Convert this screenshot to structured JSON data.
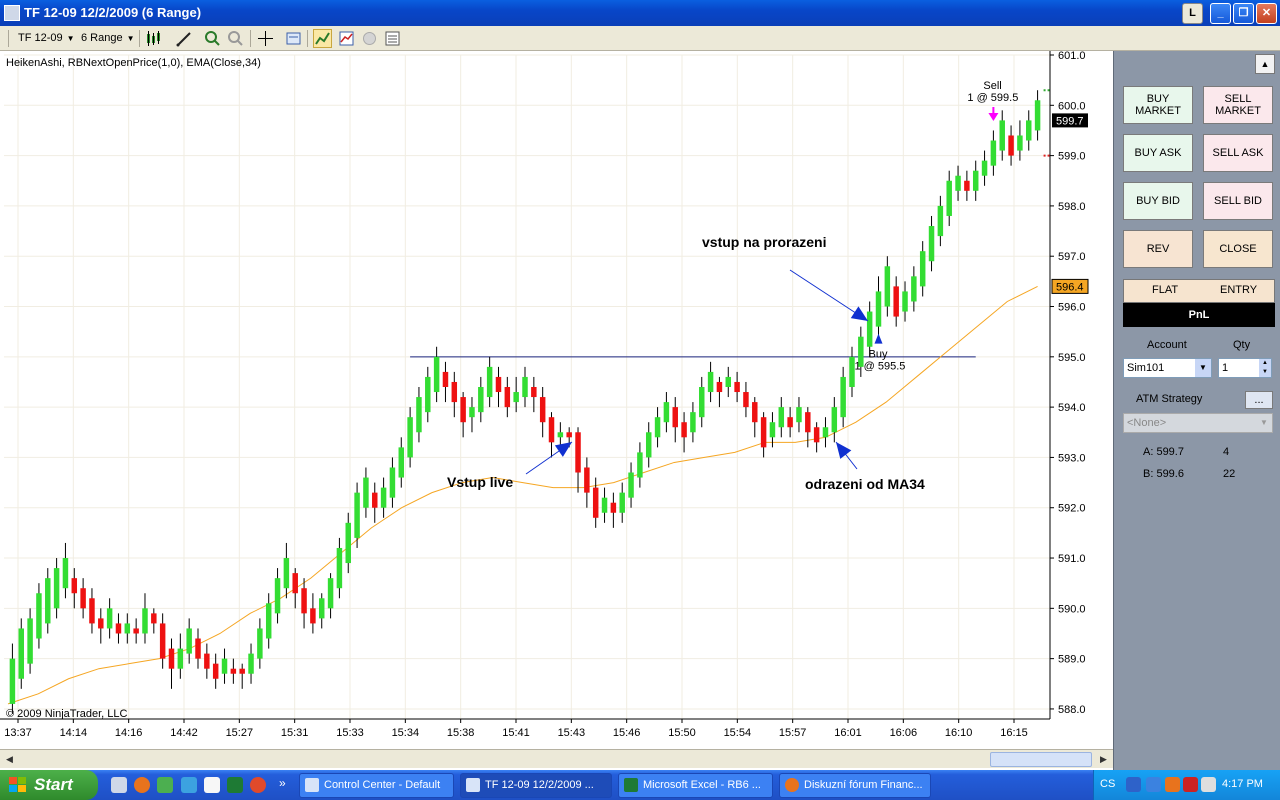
{
  "window": {
    "title": "TF 12-09  12/2/2009 (6 Range)",
    "l_button": "L",
    "minimize_glyph": "_",
    "maximize_glyph": "❐",
    "close_glyph": "✕"
  },
  "toolbar": {
    "instrument": "TF 12-09",
    "period": "6 Range",
    "dropdown_arrow": "▼"
  },
  "chart": {
    "indicator_label": "HeikenAshi, RBNextOpenPrice(1,0), EMA(Close,34)",
    "copyright": "© 2009 NinjaTrader, LLC",
    "annotations": {
      "entry_breakout": "vstup na prorazeni",
      "entry_live": "Vstup live",
      "bounce_ma": "odrazeni od MA34",
      "buy_label": "Buy",
      "buy_fill": "1 @ 595.5",
      "sell_label": "Sell",
      "sell_fill": "1 @ 599.5"
    },
    "price_markers": {
      "last": "599.7",
      "ema": "596.4"
    },
    "colors": {
      "up": "#33dd33",
      "down": "#ee1111",
      "ema": "#f5a623",
      "level": "#1a237e",
      "arrow": "#1030d0",
      "sell_arrow": "#ff00ff",
      "last_bg": "#000000",
      "ema_bg": "#f5a623"
    }
  },
  "chart_data": {
    "type": "candlestick",
    "ylim": [
      587.8,
      601.0
    ],
    "y_ticks": [
      "601.0",
      "600.0",
      "599.0",
      "598.0",
      "597.0",
      "596.0",
      "595.0",
      "594.0",
      "593.0",
      "592.0",
      "591.0",
      "590.0",
      "589.0",
      "588.0"
    ],
    "x_ticks": [
      "13:37",
      "14:14",
      "14:16",
      "14:42",
      "15:27",
      "15:31",
      "15:33",
      "15:34",
      "15:38",
      "15:41",
      "15:43",
      "15:46",
      "15:50",
      "15:54",
      "15:57",
      "16:01",
      "16:06",
      "16:10",
      "16:15"
    ],
    "horizontal_level": 595.0,
    "candles": [
      [
        588.1,
        589.0,
        587.9,
        589.3
      ],
      [
        588.6,
        589.6,
        588.4,
        589.8
      ],
      [
        588.9,
        589.8,
        588.7,
        590.0
      ],
      [
        589.4,
        590.3,
        589.2,
        590.5
      ],
      [
        589.7,
        590.6,
        589.5,
        590.8
      ],
      [
        590.0,
        590.8,
        589.8,
        591.0
      ],
      [
        590.4,
        591.0,
        590.2,
        591.3
      ],
      [
        590.6,
        590.3,
        590.0,
        590.8
      ],
      [
        590.4,
        590.0,
        589.8,
        590.6
      ],
      [
        590.2,
        589.7,
        589.5,
        590.4
      ],
      [
        589.8,
        589.6,
        589.3,
        590.0
      ],
      [
        589.6,
        590.0,
        589.4,
        590.2
      ],
      [
        589.7,
        589.5,
        589.3,
        589.9
      ],
      [
        589.5,
        589.7,
        589.3,
        589.9
      ],
      [
        589.6,
        589.5,
        589.3,
        589.8
      ],
      [
        589.5,
        590.0,
        589.3,
        590.3
      ],
      [
        589.9,
        589.7,
        589.5,
        590.0
      ],
      [
        589.7,
        589.0,
        588.8,
        589.9
      ],
      [
        589.2,
        588.8,
        588.4,
        589.4
      ],
      [
        588.8,
        589.2,
        588.6,
        589.5
      ],
      [
        589.1,
        589.6,
        588.9,
        589.8
      ],
      [
        589.4,
        589.0,
        588.8,
        589.6
      ],
      [
        589.1,
        588.8,
        588.6,
        589.3
      ],
      [
        588.9,
        588.6,
        588.4,
        589.1
      ],
      [
        588.7,
        589.0,
        588.5,
        589.2
      ],
      [
        588.8,
        588.7,
        588.5,
        589.0
      ],
      [
        588.8,
        588.7,
        588.4,
        588.9
      ],
      [
        588.7,
        589.1,
        588.5,
        589.3
      ],
      [
        589.0,
        589.6,
        588.8,
        589.8
      ],
      [
        589.4,
        590.1,
        589.2,
        590.3
      ],
      [
        589.9,
        590.6,
        589.7,
        590.8
      ],
      [
        590.4,
        591.0,
        590.2,
        591.3
      ],
      [
        590.7,
        590.3,
        590.0,
        590.8
      ],
      [
        590.4,
        589.9,
        589.6,
        590.6
      ],
      [
        590.0,
        589.7,
        589.5,
        590.3
      ],
      [
        589.8,
        590.2,
        589.6,
        590.3
      ],
      [
        590.0,
        590.6,
        589.8,
        590.7
      ],
      [
        590.4,
        591.2,
        590.2,
        591.4
      ],
      [
        590.9,
        591.7,
        590.7,
        591.9
      ],
      [
        591.4,
        592.3,
        591.2,
        592.5
      ],
      [
        592.0,
        592.6,
        591.8,
        592.8
      ],
      [
        592.3,
        592.0,
        591.7,
        592.5
      ],
      [
        592.0,
        592.4,
        591.8,
        592.6
      ],
      [
        592.2,
        592.8,
        592.0,
        593.0
      ],
      [
        592.6,
        593.2,
        592.4,
        593.4
      ],
      [
        593.0,
        593.8,
        592.8,
        594.0
      ],
      [
        593.5,
        594.2,
        593.3,
        594.4
      ],
      [
        593.9,
        594.6,
        593.7,
        594.8
      ],
      [
        594.3,
        595.0,
        594.1,
        595.2
      ],
      [
        594.7,
        594.4,
        594.1,
        594.9
      ],
      [
        594.5,
        594.1,
        593.8,
        594.7
      ],
      [
        594.2,
        593.7,
        593.4,
        594.3
      ],
      [
        593.8,
        594.0,
        593.5,
        594.2
      ],
      [
        593.9,
        594.4,
        593.7,
        594.6
      ],
      [
        594.2,
        594.8,
        594.0,
        595.0
      ],
      [
        594.6,
        594.3,
        594.0,
        594.8
      ],
      [
        594.4,
        594.0,
        593.8,
        594.6
      ],
      [
        594.1,
        594.3,
        593.9,
        594.6
      ],
      [
        594.2,
        594.6,
        594.0,
        594.8
      ],
      [
        594.4,
        594.2,
        593.9,
        594.6
      ],
      [
        594.2,
        593.7,
        593.4,
        594.4
      ],
      [
        593.8,
        593.3,
        593.0,
        593.9
      ],
      [
        593.4,
        593.5,
        593.2,
        593.7
      ],
      [
        593.5,
        593.4,
        593.2,
        593.6
      ],
      [
        593.5,
        592.7,
        592.3,
        593.6
      ],
      [
        592.8,
        592.3,
        592.0,
        593.0
      ],
      [
        592.4,
        591.8,
        591.6,
        592.6
      ],
      [
        591.9,
        592.2,
        591.7,
        592.4
      ],
      [
        592.1,
        591.9,
        591.6,
        592.3
      ],
      [
        591.9,
        592.3,
        591.7,
        592.5
      ],
      [
        592.2,
        592.7,
        592.0,
        592.9
      ],
      [
        592.6,
        593.1,
        592.4,
        593.3
      ],
      [
        593.0,
        593.5,
        592.8,
        593.7
      ],
      [
        593.4,
        593.8,
        593.2,
        594.0
      ],
      [
        593.7,
        594.1,
        593.5,
        594.3
      ],
      [
        594.0,
        593.6,
        593.3,
        594.2
      ],
      [
        593.7,
        593.4,
        593.1,
        593.9
      ],
      [
        593.5,
        593.9,
        593.3,
        594.1
      ],
      [
        593.8,
        594.4,
        593.6,
        594.6
      ],
      [
        594.3,
        594.7,
        594.1,
        594.9
      ],
      [
        594.5,
        594.3,
        594.0,
        594.6
      ],
      [
        594.4,
        594.6,
        594.2,
        594.8
      ],
      [
        594.5,
        594.3,
        594.1,
        594.7
      ],
      [
        594.3,
        594.0,
        593.8,
        594.5
      ],
      [
        594.1,
        593.7,
        593.4,
        594.2
      ],
      [
        593.8,
        593.2,
        593.0,
        593.9
      ],
      [
        593.4,
        593.7,
        593.2,
        593.9
      ],
      [
        593.6,
        594.0,
        593.4,
        594.2
      ],
      [
        593.8,
        593.6,
        593.4,
        594.0
      ],
      [
        593.7,
        594.0,
        593.5,
        594.2
      ],
      [
        593.9,
        593.5,
        593.2,
        594.0
      ],
      [
        593.6,
        593.3,
        593.1,
        593.7
      ],
      [
        593.4,
        593.6,
        593.2,
        593.8
      ],
      [
        593.5,
        594.0,
        593.3,
        594.2
      ],
      [
        593.8,
        594.6,
        593.6,
        594.8
      ],
      [
        594.4,
        595.0,
        594.2,
        595.2
      ],
      [
        594.8,
        595.4,
        594.6,
        595.6
      ],
      [
        595.2,
        595.9,
        595.0,
        596.1
      ],
      [
        595.6,
        596.3,
        595.4,
        596.6
      ],
      [
        596.0,
        596.8,
        595.8,
        597.0
      ],
      [
        596.4,
        595.8,
        595.6,
        596.6
      ],
      [
        595.9,
        596.3,
        595.7,
        596.5
      ],
      [
        596.1,
        596.6,
        595.9,
        596.8
      ],
      [
        596.4,
        597.1,
        596.2,
        597.3
      ],
      [
        596.9,
        597.6,
        596.7,
        597.8
      ],
      [
        597.4,
        598.0,
        597.2,
        598.2
      ],
      [
        597.8,
        598.5,
        597.6,
        598.7
      ],
      [
        598.3,
        598.6,
        598.1,
        598.8
      ],
      [
        598.5,
        598.3,
        598.1,
        598.7
      ],
      [
        598.3,
        598.7,
        598.1,
        598.9
      ],
      [
        598.6,
        598.9,
        598.4,
        599.1
      ],
      [
        598.8,
        599.3,
        598.6,
        599.5
      ],
      [
        599.1,
        599.7,
        598.9,
        599.9
      ],
      [
        599.4,
        599.0,
        598.8,
        599.6
      ],
      [
        599.1,
        599.4,
        598.9,
        599.7
      ],
      [
        599.3,
        599.7,
        599.1,
        599.9
      ],
      [
        599.5,
        600.1,
        599.3,
        600.3
      ]
    ],
    "ema": [
      588.1,
      588.3,
      588.6,
      588.8,
      588.9,
      589.0,
      589.2,
      589.5,
      589.9,
      590.2,
      590.6,
      591.1,
      591.6,
      592.0,
      592.3,
      592.5,
      592.6,
      592.5,
      592.4,
      592.4,
      592.5,
      592.7,
      592.9,
      593.0,
      593.1,
      593.3,
      593.3,
      593.4,
      593.7,
      594.1,
      594.6,
      595.1,
      595.6,
      596.1,
      596.4
    ]
  },
  "panel": {
    "scroll_up": "▲",
    "buy_market": [
      "BUY",
      "MARKET"
    ],
    "sell_market": [
      "SELL",
      "MARKET"
    ],
    "buy_ask": "BUY ASK",
    "sell_ask": "SELL ASK",
    "buy_bid": "BUY BID",
    "sell_bid": "SELL BID",
    "rev": "REV",
    "close": "CLOSE",
    "flat": "FLAT",
    "entry": "ENTRY",
    "pnl": "PnL",
    "account_label": "Account",
    "account_value": "Sim101",
    "qty_label": "Qty",
    "qty_value": "1",
    "atm_label": "ATM Strategy",
    "atm_button": "...",
    "atm_value": "<None>",
    "ask_label": "A: 599.7",
    "ask_size": "4",
    "bid_label": "B: 599.6",
    "bid_size": "22"
  },
  "taskbar": {
    "start": "Start",
    "more": "»",
    "tasks": [
      "Control Center - Default",
      "TF 12-09  12/2/2009 ...",
      "Microsoft Excel - RB6 ...",
      "Diskuzní fórum Financ..."
    ],
    "lang": "CS",
    "clock": "4:17 PM"
  }
}
